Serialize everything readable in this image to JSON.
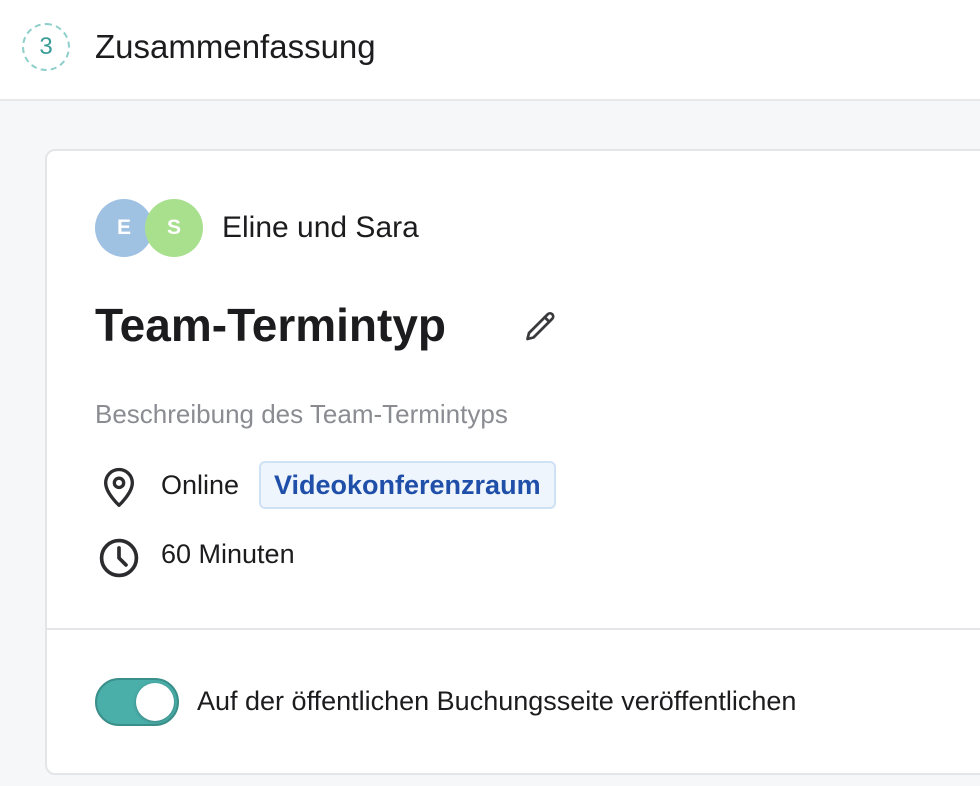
{
  "header": {
    "step_number": "3",
    "title": "Zusammenfassung"
  },
  "card": {
    "hosts": {
      "avatars": [
        {
          "initial": "E",
          "color": "#9fc1e2"
        },
        {
          "initial": "S",
          "color": "#a9e08e"
        }
      ],
      "names": "Eline und Sara"
    },
    "title": "Team-Termintyp",
    "edit_icon": "pencil-icon",
    "description": "Beschreibung des Team-Termintyps",
    "location": {
      "icon": "map-pin-icon",
      "label": "Online",
      "chip": "Videokonferenzraum"
    },
    "duration": {
      "icon": "clock-icon",
      "label": "60 Minuten"
    },
    "publish_toggle": {
      "label": "Auf der öffentlichen Buchungsseite veröffentlichen",
      "checked": true,
      "color": "#4aaea9"
    }
  }
}
